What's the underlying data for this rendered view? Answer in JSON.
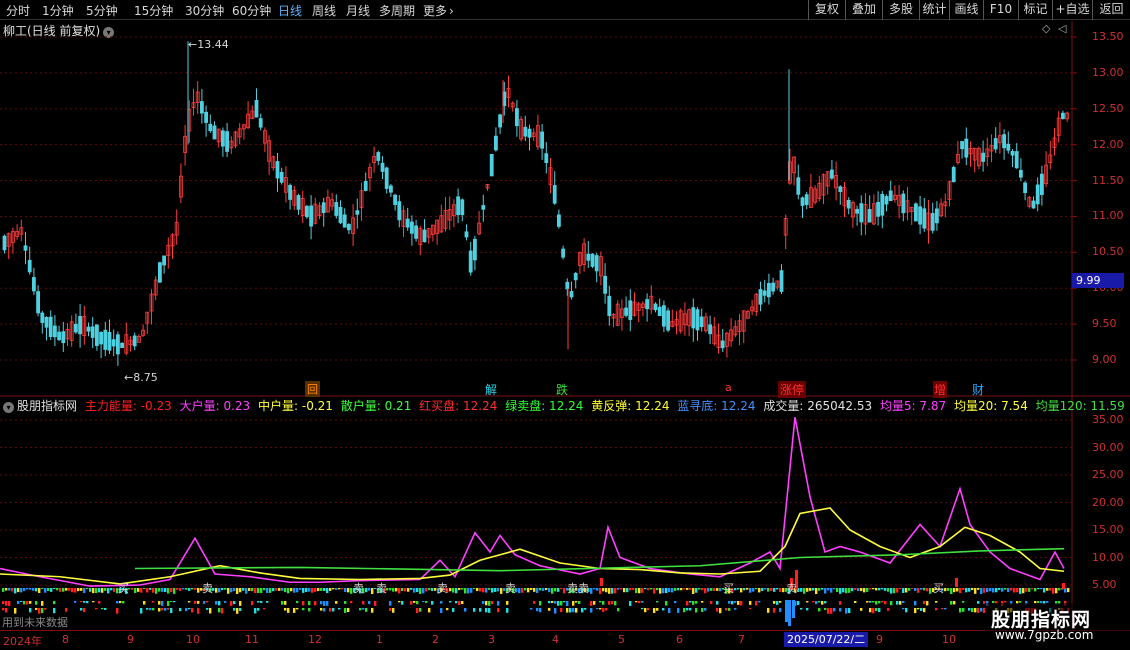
{
  "toolbar": {
    "left_items": [
      {
        "label": "分时",
        "active": false
      },
      {
        "label": "1分钟",
        "active": false
      },
      {
        "label": "5分钟",
        "active": false
      },
      {
        "label": "15分钟",
        "active": false
      },
      {
        "label": "30分钟",
        "active": false
      },
      {
        "label": "60分钟",
        "active": false
      },
      {
        "label": "日线",
        "active": true
      },
      {
        "label": "周线",
        "active": false
      },
      {
        "label": "月线",
        "active": false
      },
      {
        "label": "多周期",
        "active": false
      },
      {
        "label": "更多",
        "active": false
      }
    ],
    "right_items": [
      "复权",
      "叠加",
      "多股",
      "统计",
      "画线",
      "F10",
      "标记",
      "+自选",
      "返回"
    ]
  },
  "k_chart": {
    "title": "柳工(日线 前复权)",
    "high_label": "13.44",
    "low_label": "8.75",
    "current_price": "9.99",
    "price_ticks": [
      "13.50",
      "13.00",
      "12.50",
      "12.00",
      "11.50",
      "11.00",
      "10.50",
      "10.00",
      "9.50",
      "9.00"
    ],
    "signals": [
      {
        "text": "回",
        "color": "#ff8a00",
        "bg": "#5a2f00"
      },
      {
        "text": "解",
        "color": "#29d4e8",
        "bg": ""
      },
      {
        "text": "跌",
        "color": "#35e035",
        "bg": ""
      },
      {
        "text": "a",
        "color": "#ff3030",
        "bg": ""
      },
      {
        "text": "涨停",
        "color": "#ff3030",
        "bg": "#6a0000"
      },
      {
        "text": "增",
        "color": "#ff3030",
        "bg": "#6a0000"
      },
      {
        "text": "财",
        "color": "#29a8ff",
        "bg": ""
      }
    ]
  },
  "indicator": {
    "name": "股朋指标网",
    "values": [
      {
        "text": "主力能量: -0.23",
        "color": "#ff2020"
      },
      {
        "text": "大户量: 0.23",
        "color": "#ff40ff"
      },
      {
        "text": "中户量: -0.21",
        "color": "#ffff40"
      },
      {
        "text": "散户量: 0.21",
        "color": "#40ff40"
      },
      {
        "text": "红买盘: 12.24",
        "color": "#ff3030"
      },
      {
        "text": "绿卖盘: 12.24",
        "color": "#30ff30"
      },
      {
        "text": "黄反弹: 12.24",
        "color": "#ffff30"
      },
      {
        "text": "蓝寻底: 12.24",
        "color": "#4090ff"
      },
      {
        "text": "成交量: 265042.53",
        "color": "#e0e0e0"
      },
      {
        "text": "均量5: 7.87",
        "color": "#ff40ff"
      },
      {
        "text": "均量20: 7.54",
        "color": "#ffff40"
      },
      {
        "text": "均量120: 11.59",
        "color": "#40e040"
      }
    ],
    "y_ticks": [
      "35.00",
      "30.00",
      "25.00",
      "20.00",
      "15.00",
      "10.00",
      "5.00"
    ],
    "markers": [
      "买",
      "卖",
      "卖",
      "卖",
      "卖",
      "卖",
      "卖卖",
      "买",
      "卖",
      "买"
    ]
  },
  "timeline": {
    "labels": [
      "2024年",
      "8",
      "9",
      "10",
      "11",
      "12",
      "1",
      "2",
      "3",
      "4",
      "5",
      "6",
      "7",
      "9",
      "10"
    ],
    "selected": "2025/07/22/二"
  },
  "footer_note": "用到未来数据",
  "watermark": {
    "title": "股朋指标网",
    "url": "www.7gpzb.com"
  }
}
